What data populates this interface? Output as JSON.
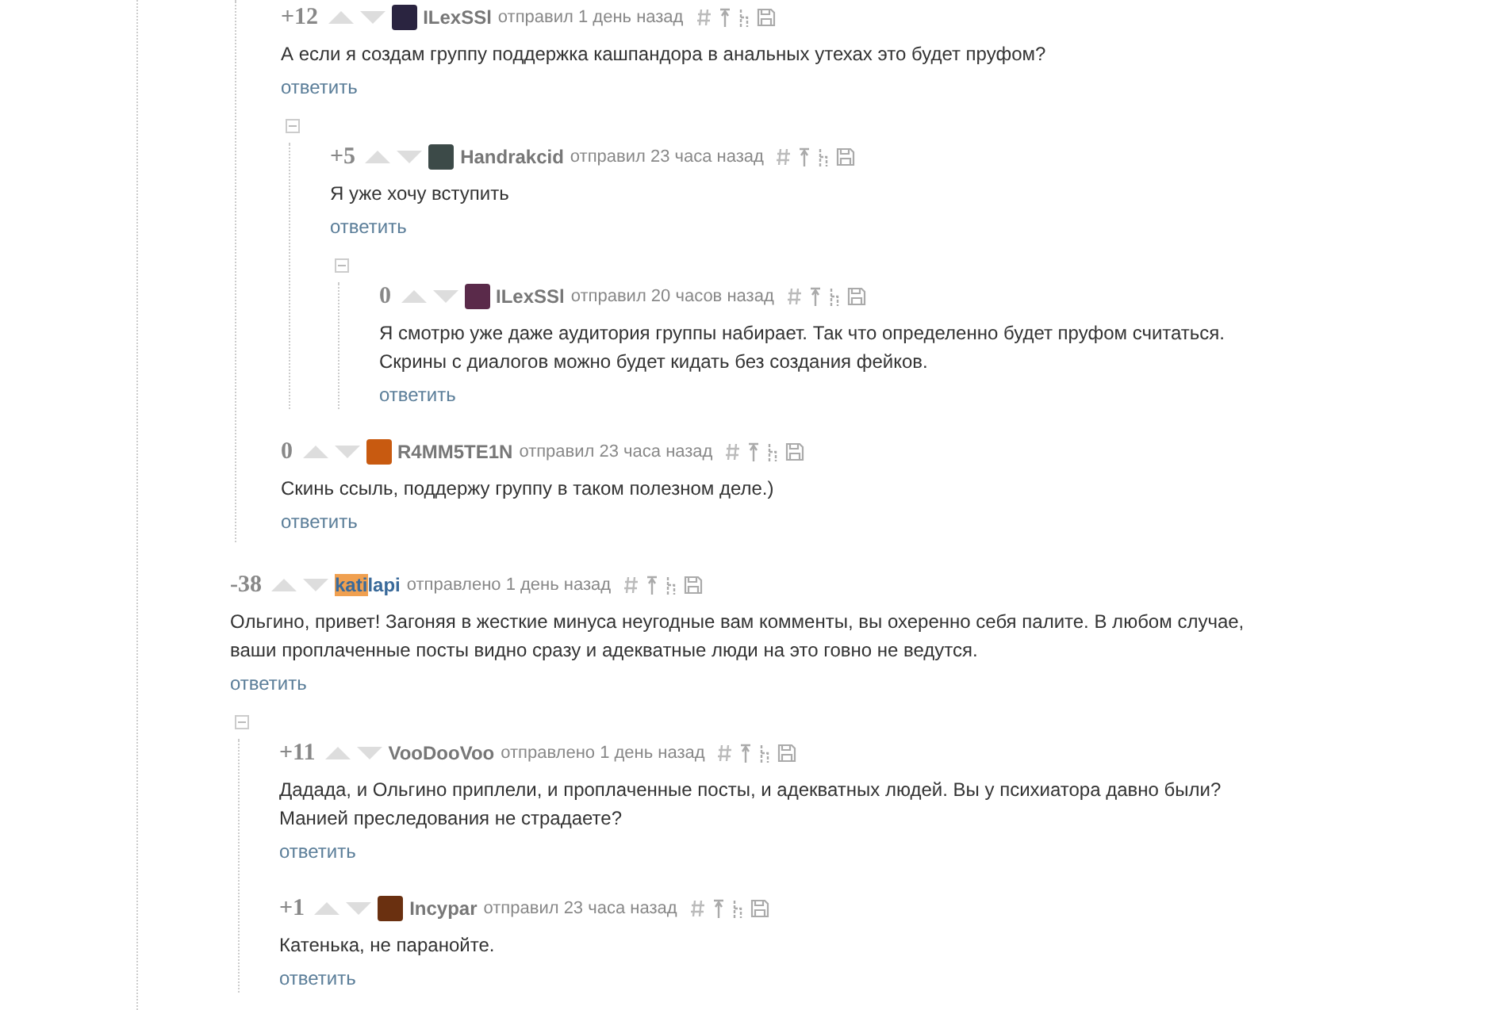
{
  "thread_tail": [
    {
      "rating": "+12",
      "avatar": {
        "color": "#2a2440"
      },
      "author_parts": [
        {
          "text": "ILexSSl",
          "highlighted": false
        }
      ],
      "meta": "отправил 1 день назад",
      "body": "А если я создам группу поддержка кашпандора в анальных утехах это будет пруфом?",
      "reply": "ответить",
      "children": [
        {
          "rating": "+5",
          "avatar": {
            "color": "#3c4a48"
          },
          "author_parts": [
            {
              "text": "Handrakcid",
              "highlighted": false
            }
          ],
          "meta": "отправил 23 часа назад",
          "body": "Я уже хочу вступить",
          "reply": "ответить",
          "children": [
            {
              "rating": "0",
              "avatar": {
                "color": "#5a2a4a"
              },
              "author_parts": [
                {
                  "text": "ILexSSl",
                  "highlighted": false
                }
              ],
              "meta": "отправил 20 часов назад",
              "body": "Я смотрю уже даже аудитория группы набирает. Так что определенно будет пруфом считаться. Скрины с диалогов можно будет кидать без создания фейков.",
              "reply": "ответить"
            }
          ]
        }
      ]
    },
    {
      "rating": "0",
      "avatar": {
        "color": "#c85a10"
      },
      "author_parts": [
        {
          "text": "R4MM5TE1N",
          "highlighted": false
        }
      ],
      "meta": "отправил 23 часа назад",
      "body": "Скинь ссыль, поддержу группу в таком полезном деле.)",
      "reply": "ответить"
    }
  ],
  "comments": [
    {
      "rating": "-38",
      "author_parts": [
        {
          "text": "kati",
          "highlighted": true
        },
        {
          "text": "lapi",
          "highlighted": false
        }
      ],
      "meta": "отправлено 1 день назад",
      "body": "Ольгино, привет! Загоняя в жесткие минуса неугодные вам комменты, вы охеренно себя палите. В любом случае, ваши проплаченные посты видно сразу и адекватные люди на это говно не ведутся.",
      "reply": "ответить",
      "children": [
        {
          "rating": "+11",
          "author_parts": [
            {
              "text": "VooDooVoo",
              "highlighted": false
            }
          ],
          "meta": "отправлено 1 день назад",
          "body": "Дадада, и Ольгино приплели, и проплаченные посты, и адекватных людей. Вы у психиатора давно были? Манией преследования не страдаете?",
          "reply": "ответить"
        },
        {
          "rating": "+1",
          "avatar": {
            "color": "#6a3010"
          },
          "author_parts": [
            {
              "text": "Incypar",
              "highlighted": false
            }
          ],
          "meta": "отправил 23 часа назад",
          "body": "Катенька, не паранойте.",
          "reply": "ответить"
        }
      ]
    }
  ]
}
